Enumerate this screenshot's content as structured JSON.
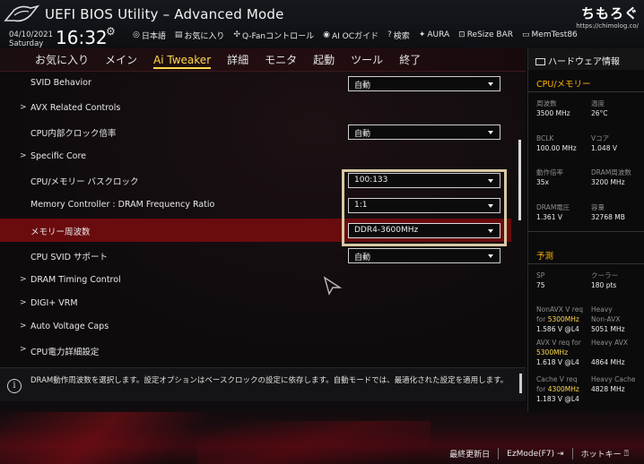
{
  "header": {
    "title": "UEFI BIOS Utility – Advanced Mode",
    "date": "04/10/2021",
    "weekday": "Saturday",
    "time": "16:32",
    "toolbar": [
      {
        "icon": "globe-icon",
        "label": "日本語"
      },
      {
        "icon": "favorite-icon",
        "label": "お気に入り"
      },
      {
        "icon": "fan-icon",
        "label": "Q-Fanコントロール"
      },
      {
        "icon": "ai-oc-icon",
        "label": "AI OCガイド"
      },
      {
        "icon": "search-icon",
        "label": "検索"
      },
      {
        "icon": "aura-icon",
        "label": "AURA"
      },
      {
        "icon": "resize-bar-icon",
        "label": "ReSize BAR"
      },
      {
        "icon": "memtest-icon",
        "label": "MemTest86"
      }
    ],
    "watermark": "ちもろぐ",
    "watermark_url": "https://chimolog.co/"
  },
  "tabs": [
    "お気に入り",
    "メイン",
    "Ai Tweaker",
    "詳細",
    "モニタ",
    "起動",
    "ツール",
    "終了"
  ],
  "active_tab": "Ai Tweaker",
  "settings": [
    {
      "label": "SVID Behavior",
      "value": "自動",
      "submenu": false
    },
    {
      "label": "AVX Related Controls",
      "value": null,
      "submenu": true
    },
    {
      "label": "CPU内部クロック倍率",
      "value": "自動",
      "submenu": false
    },
    {
      "label": "Specific Core",
      "value": null,
      "submenu": true
    },
    {
      "label": "CPU/メモリー バスクロック",
      "value": "100:133",
      "submenu": false
    },
    {
      "label": "Memory Controller : DRAM Frequency Ratio",
      "value": "1:1",
      "submenu": false
    },
    {
      "label": "メモリー周波数",
      "value": "DDR4-3600MHz",
      "submenu": false,
      "selected": true
    },
    {
      "label": "CPU SVID サポート",
      "value": "自動",
      "submenu": false
    },
    {
      "label": "DRAM Timing Control",
      "value": null,
      "submenu": true
    },
    {
      "label": "DIGI+ VRM",
      "value": null,
      "submenu": true
    },
    {
      "label": "Auto Voltage Caps",
      "value": null,
      "submenu": true
    },
    {
      "label": "CPU電力詳細設定",
      "value": null,
      "submenu": true
    }
  ],
  "help_text": "DRAM動作周波数を選択します。設定オプションはベースクロックの設定に依存します。自動モードでは、最適化された設定を適用します。",
  "footer": [
    {
      "label": "最終更新日",
      "icon": null
    },
    {
      "label": "EzMode(F7)",
      "icon": "exit-icon"
    },
    {
      "label": "ホットキー",
      "icon": "help-icon"
    }
  ],
  "hw_monitor": {
    "title": "ハードウェア情報",
    "cpu_section": "CPU/メモリー",
    "cpu": [
      {
        "k": "周波数",
        "v": "3500 MHz"
      },
      {
        "k": "温度",
        "v": "26°C"
      },
      {
        "k": "BCLK",
        "v": "100.00 MHz"
      },
      {
        "k": "Vコア",
        "v": "1.048 V"
      },
      {
        "k": "動作倍率",
        "v": "35x"
      },
      {
        "k": "DRAM周波数",
        "v": "3200 MHz"
      },
      {
        "k": "DRAM電圧",
        "v": "1.361 V"
      },
      {
        "k": "容量",
        "v": "32768 MB"
      }
    ],
    "predict_section": "予測",
    "predict": {
      "sp_k": "SP",
      "sp_v": "75",
      "cooler_k": "クーラー",
      "cooler_v": "180 pts",
      "nonavx_k1": "NonAVX V req",
      "nonavx_k2": "for",
      "nonavx_freq": "5300MHz",
      "nonavx_v": "1.586 V @L4",
      "heavy_nonavx_k": "Heavy",
      "heavy_nonavx_k2": "Non-AVX",
      "heavy_nonavx_v": "5051 MHz",
      "avx_k1": "AVX V req",
      "avx_k2": "for",
      "avx_freq": "5300MHz",
      "avx_v": "1.618 V @L4",
      "heavy_avx_k": "Heavy AVX",
      "heavy_avx_v": "4864 MHz",
      "cache_k1": "Cache V req",
      "cache_k2": "for",
      "cache_freq": "4300MHz",
      "cache_v": "1.183 V @L4",
      "heavy_cache_k": "Heavy Cache",
      "heavy_cache_v": "4828 MHz"
    }
  },
  "colors": {
    "accent": "#ffd94a",
    "section": "#ffb400",
    "highlight_row": "#6a0b0e"
  }
}
